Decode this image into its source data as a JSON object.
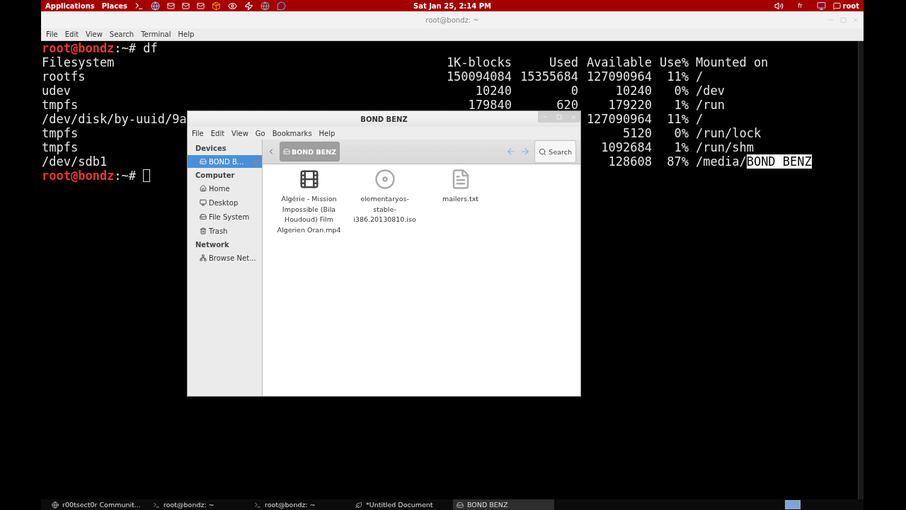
{
  "top_panel": {
    "menus": [
      "Applications",
      "Places"
    ],
    "clock": "Sat Jan 25,  2:14 PM",
    "keyboard_layout": "fr",
    "user": "root"
  },
  "terminal": {
    "title": "root@bondz: ~",
    "menu": [
      "File",
      "Edit",
      "View",
      "Search",
      "Terminal",
      "Help"
    ],
    "prompt_before": {
      "user": "root@bondz",
      "sep": ":",
      "path": "~",
      "symbol": "#",
      "command": "df"
    },
    "df": {
      "columns": [
        "Filesystem",
        "1K-blocks",
        "Used",
        "Available",
        "Use%",
        "Mounted on"
      ],
      "rows": [
        {
          "filesystem": "rootfs",
          "blocks": "150094084",
          "used": "15355684",
          "available": "127090964",
          "use": "11%",
          "mounted": [
            {
              "text": "/",
              "selected": false
            }
          ]
        },
        {
          "filesystem": "udev",
          "blocks": "10240",
          "used": "0",
          "available": "10240",
          "use": "0%",
          "mounted": [
            {
              "text": "/dev",
              "selected": false
            }
          ]
        },
        {
          "filesystem": "tmpfs",
          "blocks": "179840",
          "used": "620",
          "available": "179220",
          "use": "1%",
          "mounted": [
            {
              "text": "/run",
              "selected": false
            }
          ]
        },
        {
          "filesystem": "/dev/disk/by-uuid/9a",
          "available": "127090964",
          "use": "11%",
          "mounted": [
            {
              "text": "/",
              "selected": false
            }
          ]
        },
        {
          "filesystem": "tmpfs",
          "available": "5120",
          "use": "0%",
          "mounted": [
            {
              "text": "/run/lock",
              "selected": false
            }
          ]
        },
        {
          "filesystem": "tmpfs",
          "available": "1092684",
          "use": "1%",
          "mounted": [
            {
              "text": "/run/shm",
              "selected": false
            }
          ]
        },
        {
          "filesystem": "/dev/sdb1",
          "available": "128608",
          "use": "87%",
          "mounted": [
            {
              "text": "/media/",
              "selected": false
            },
            {
              "text": "BOND BENZ",
              "selected": true
            }
          ]
        }
      ]
    },
    "prompt_after": {
      "user": "root@bondz",
      "sep": ":",
      "path": "~",
      "symbol": "#"
    }
  },
  "file_manager": {
    "title": "BOND BENZ",
    "menu": [
      "File",
      "Edit",
      "View",
      "Go",
      "Bookmarks",
      "Help"
    ],
    "sidebar": [
      {
        "heading": "Devices",
        "items": [
          {
            "label": "BOND B...",
            "kind": "drive",
            "selected": true,
            "eject": true
          }
        ]
      },
      {
        "heading": "Computer",
        "items": [
          {
            "label": "Home",
            "kind": "home",
            "selected": false,
            "eject": false
          },
          {
            "label": "Desktop",
            "kind": "desktop",
            "selected": false,
            "eject": false
          },
          {
            "label": "File System",
            "kind": "drive",
            "selected": false,
            "eject": false
          },
          {
            "label": "Trash",
            "kind": "trash",
            "selected": false,
            "eject": false
          }
        ]
      },
      {
        "heading": "Network",
        "items": [
          {
            "label": "Browse Net...",
            "kind": "network",
            "selected": false,
            "eject": false
          }
        ]
      }
    ],
    "path": "BOND BENZ",
    "search": "Search",
    "files": [
      {
        "name": "Algérie - Mission Impossible (Bila Houdoud) Film Algerien Oran.mp4",
        "kind": "video"
      },
      {
        "name": "elementaryos-stable-i386.20130810.iso",
        "kind": "disc"
      },
      {
        "name": "mailers.txt",
        "kind": "text"
      }
    ]
  },
  "taskbar": [
    {
      "label": "r00tsect0r Communit...",
      "kind": "browser",
      "selected": false
    },
    {
      "label": "root@bondz: ~",
      "kind": "terminal",
      "selected": false
    },
    {
      "label": "root@bondz: ~",
      "kind": "terminal",
      "selected": false
    },
    {
      "label": "*Untitled Document",
      "kind": "editor",
      "selected": false
    },
    {
      "label": "BOND BENZ",
      "kind": "files",
      "selected": true
    }
  ]
}
